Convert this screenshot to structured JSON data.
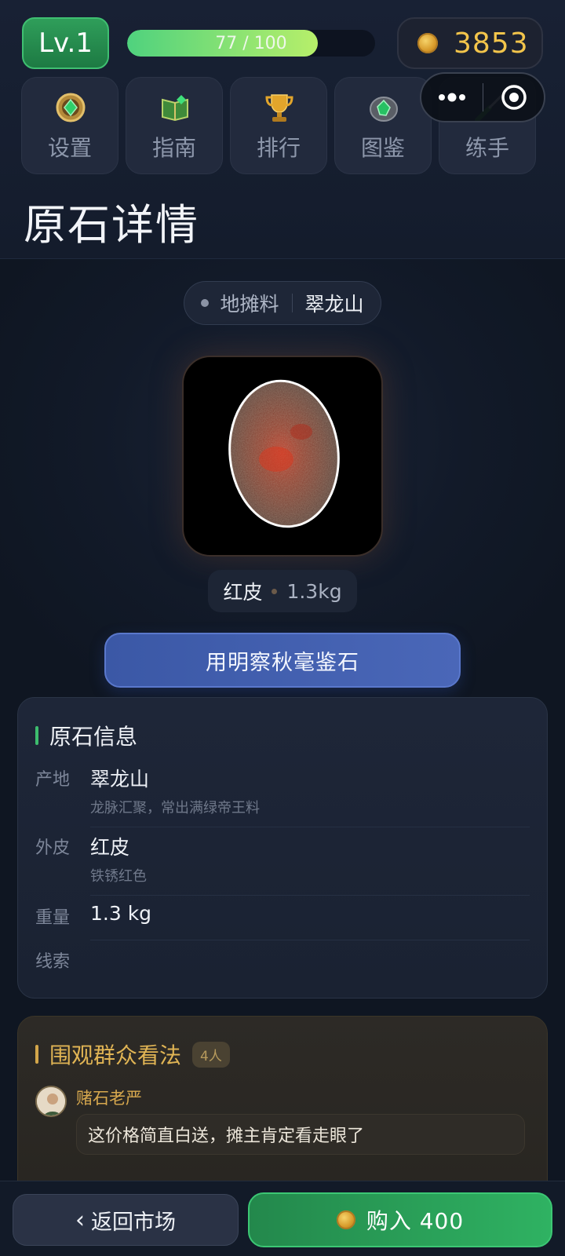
{
  "header": {
    "level": "Lv.1",
    "xp_text": "77 / 100",
    "xp_progress": 0.77,
    "coins": "3853",
    "coin_icon": "gold-coin-icon"
  },
  "nav": [
    {
      "label": "设置",
      "icon": "gem-medallion-icon"
    },
    {
      "label": "指南",
      "icon": "book-gem-icon"
    },
    {
      "label": "排行",
      "icon": "trophy-icon"
    },
    {
      "label": "图鉴",
      "icon": "jade-stone-icon"
    },
    {
      "label": "练手",
      "icon": "carving-knife-icon"
    }
  ],
  "capsule": {
    "more_icon": "more-dots-icon",
    "close_icon": "close-target-icon"
  },
  "page": {
    "title": "原石详情"
  },
  "stone": {
    "grade": "地摊料",
    "origin": "翠龙山",
    "skin": "红皮",
    "weight": "1.3kg",
    "appraise_label": "用明察秋毫鉴石"
  },
  "info": {
    "title": "原石信息",
    "rows": [
      {
        "key": "产地",
        "value": "翠龙山",
        "sub": "龙脉汇聚，常出满绿帝王料"
      },
      {
        "key": "外皮",
        "value": "红皮",
        "sub": "铁锈红色"
      },
      {
        "key": "重量",
        "value": "1.3 kg",
        "sub": ""
      },
      {
        "key": "线索",
        "value": "",
        "sub": ""
      }
    ]
  },
  "comments": {
    "title": "围观群众看法",
    "count": "4人",
    "items": [
      {
        "name": "赌石老严",
        "text": "这价格简直白送，摊主肯定看走眼了"
      }
    ]
  },
  "footer": {
    "back_label": "返回市场",
    "buy_label": "购入 400"
  },
  "colors": {
    "accent_green": "#2fb262",
    "gold": "#f3c54b",
    "blue_button": "#4a67b8"
  }
}
